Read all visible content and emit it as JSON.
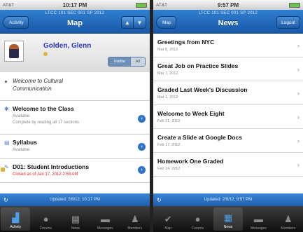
{
  "left": {
    "status": {
      "carrier": "AT&T",
      "time": "10:17 PM"
    },
    "nav": {
      "back_label": "Activity",
      "marquee": "LTCC 101 SEC 001 SP 2012",
      "title": "Map",
      "up_icon": "triangle-up",
      "down_icon": "triangle-down"
    },
    "profile": {
      "name": "Golden, Glenn",
      "toggle_on": "Visible",
      "toggle_off": "All"
    },
    "welcome": {
      "line1": "Welcome to Cultural",
      "line2": "Communication"
    },
    "rows": [
      {
        "title": "Welcome to the Class",
        "sub1": "Available",
        "sub2": "Complete by reading all 17 sections"
      },
      {
        "title": "Syllabus",
        "sub1": "Available"
      },
      {
        "title": "D01: Student Introductions",
        "sub1": "Closed as of Jan 17, 2012 2:58 AM"
      }
    ],
    "footer": {
      "updated": "Updated: 2/8/12, 10:17 PM"
    },
    "tabs": [
      "Activity",
      "Forums",
      "News",
      "Messages",
      "Members"
    ],
    "active_tab": "Activity"
  },
  "right": {
    "status": {
      "carrier": "AT&T",
      "time": "9:57 PM"
    },
    "nav": {
      "back_label": "Map",
      "marquee": "LTCC 101 SEC 001 SP 2012",
      "title": "News",
      "right_label": "Logout"
    },
    "news": [
      {
        "title": "Greetings from NYC",
        "date": "Mar 8, 2012"
      },
      {
        "title": "Great Job on Practice Slides",
        "date": "Mar 7, 2012"
      },
      {
        "title": "Graded Last Week's Discussion",
        "date": "Mar 1, 2012"
      },
      {
        "title": "Welcome to Week Eight",
        "date": "Feb 21, 2012"
      },
      {
        "title": "Create a Slide at Google Docs",
        "date": "Feb 17, 2012"
      },
      {
        "title": "Homework One Graded",
        "date": "Feb 14, 2012"
      }
    ],
    "footer": {
      "updated": "Updated: 2/8/12, 9:57 PM"
    },
    "tabs": [
      "Map",
      "Forums",
      "News",
      "Messages",
      "Members"
    ],
    "active_tab": "News"
  },
  "colors": {
    "nav_blue": "#1a58a8",
    "accent_blue": "#2f72c9",
    "closed_red": "#dd2222",
    "name_blue": "#2b36c9"
  }
}
